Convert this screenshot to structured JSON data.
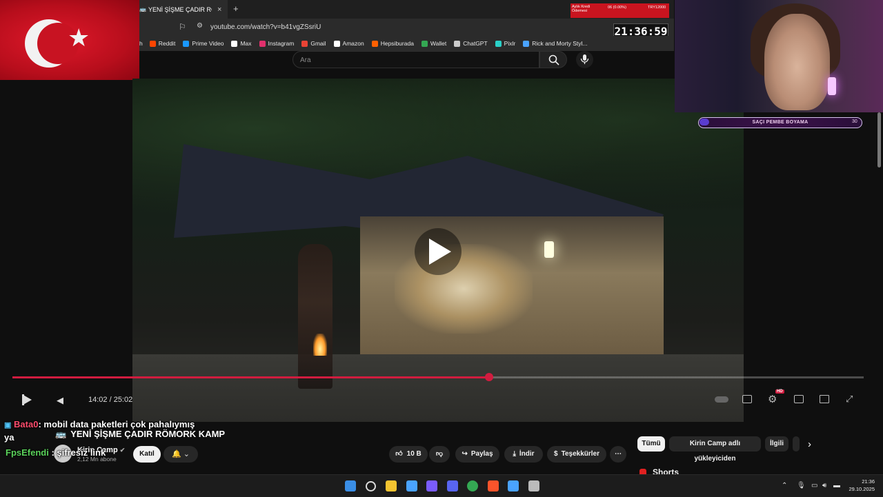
{
  "browser": {
    "tab_title": "YENİ ŞİŞME ÇADIR RÖMORK",
    "tab_close": "×",
    "new_tab": "+",
    "url": "youtube.com/watch?v=b41vgZSsriU",
    "bookmarks": [
      {
        "label": "Reddit",
        "icon": "reddit-icon",
        "color": "#ff4500"
      },
      {
        "label": "Prime Video",
        "icon": "prime-video-icon",
        "color": "#1a98ff"
      },
      {
        "label": "Max",
        "icon": "max-icon",
        "color": "#ffffff"
      },
      {
        "label": "Instagram",
        "icon": "instagram-icon",
        "color": "#e1306c"
      },
      {
        "label": "Gmail",
        "icon": "gmail-icon",
        "color": "#ea4335"
      },
      {
        "label": "Amazon",
        "icon": "amazon-icon",
        "color": "#ffffff"
      },
      {
        "label": "Hepsiburada",
        "icon": "hepsiburada-icon",
        "color": "#ff6000"
      },
      {
        "label": "Wallet",
        "icon": "wallet-icon",
        "color": "#34a853"
      },
      {
        "label": "ChatGPT",
        "icon": "chatgpt-icon",
        "color": "#cccccc"
      },
      {
        "label": "Pixlr",
        "icon": "pixlr-icon",
        "color": "#2ad0c8"
      },
      {
        "label": "Rick and Morty Styl...",
        "icon": "rick-morty-icon",
        "color": "#4aa3ff"
      }
    ]
  },
  "overlay": {
    "bank_label": "Aylık Kredi Ödemesi",
    "bank_rate": "06 (0.00%)",
    "bank_amount": "TRY12000",
    "clock": "21:36:59",
    "banner_text": "SAÇI PEMBE BOYAMA",
    "banner_count": "30"
  },
  "youtube": {
    "search_placeholder": "Ara",
    "video_title": "YENİ ŞİŞME ÇADIR RÖMORK KAMP",
    "channel_name": "Kirin Camp",
    "subscribers": "2,12 Mn abone",
    "join_label": "Katıl",
    "likes": "10 B",
    "share_label": "Paylaş",
    "download_label": "İndir",
    "thanks_label": "Teşekkürler",
    "more_label": "⋯",
    "current_time": "14:02",
    "duration": "25:02",
    "time_display": "14:02 / 25:02",
    "progress_fraction": 0.56,
    "chips": [
      "Tümü",
      "Kirin Camp adlı yükleyiciden",
      "İlgili"
    ],
    "shorts_label": "Shorts",
    "hd_badge": "HD"
  },
  "chat": [
    {
      "user": "Bata0",
      "message": ": mobil data paketleri çok pahalıymış",
      "continued": "ya"
    },
    {
      "user": "FpsEfendi",
      "message": ": şifresiz link"
    }
  ],
  "taskbar": {
    "time": "21:36",
    "date": "29.10.2025",
    "apps": [
      "windows-start-icon",
      "search-icon",
      "file-explorer-icon",
      "store-icon",
      "app-icon",
      "discord-icon",
      "chrome-icon",
      "brave-icon",
      "app2-icon",
      "app3-icon"
    ]
  }
}
